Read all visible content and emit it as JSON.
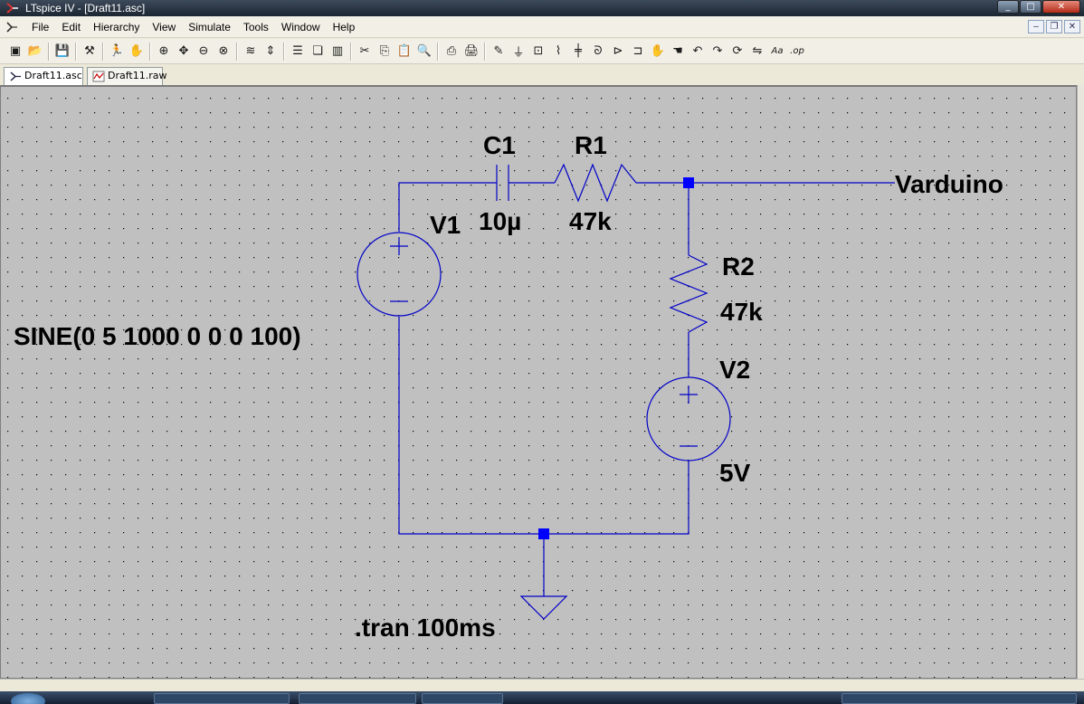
{
  "window": {
    "title": "LTspice IV - [Draft11.asc]",
    "controls": {
      "minimize": "_",
      "maximize": "□",
      "close": "✕"
    }
  },
  "menubar": {
    "items": [
      "File",
      "Edit",
      "Hierarchy",
      "View",
      "Simulate",
      "Tools",
      "Window",
      "Help"
    ],
    "mdi_controls": {
      "minimize": "–",
      "restore": "❐",
      "close": "✕"
    }
  },
  "toolbar": {
    "groups": [
      [
        "new-schematic-icon",
        "open-icon"
      ],
      [
        "save-icon"
      ],
      [
        "control-panel-icon"
      ],
      [
        "run-icon",
        "halt-icon"
      ],
      [
        "zoom-in-icon",
        "pan-icon",
        "zoom-out-icon",
        "zoom-fit-icon"
      ],
      [
        "waveform-icon",
        "autorange-icon"
      ],
      [
        "tile-horizontal-icon",
        "cascade-icon",
        "tile-vertical-icon"
      ],
      [
        "cut-icon",
        "copy-icon",
        "paste-icon",
        "find-icon"
      ],
      [
        "print-setup-icon",
        "print-icon"
      ],
      [
        "wire-icon",
        "ground-icon",
        "label-net-icon",
        "resistor-icon",
        "capacitor-icon",
        "inductor-icon",
        "diode-icon",
        "component-icon",
        "move-icon",
        "drag-icon",
        "undo-icon",
        "redo-icon",
        "rotate-icon",
        "mirror-icon",
        "text-icon",
        "spice-directive-icon"
      ]
    ],
    "glyphs": {
      "new-schematic-icon": "▣",
      "open-icon": "📂",
      "save-icon": "💾",
      "control-panel-icon": "⚒",
      "run-icon": "🏃",
      "halt-icon": "✋",
      "zoom-in-icon": "⊕",
      "pan-icon": "✥",
      "zoom-out-icon": "⊖",
      "zoom-fit-icon": "⊗",
      "waveform-icon": "≋",
      "autorange-icon": "⇕",
      "tile-horizontal-icon": "☰",
      "cascade-icon": "❏",
      "tile-vertical-icon": "▥",
      "cut-icon": "✂",
      "copy-icon": "⎘",
      "paste-icon": "📋",
      "find-icon": "🔍",
      "print-setup-icon": "⎙",
      "print-icon": "🖨",
      "wire-icon": "✎",
      "ground-icon": "⏚",
      "label-net-icon": "⊡",
      "resistor-icon": "⌇",
      "capacitor-icon": "╪",
      "inductor-icon": "ᘐ",
      "diode-icon": "⊳",
      "component-icon": "⊐",
      "move-icon": "✋",
      "drag-icon": "☚",
      "undo-icon": "↶",
      "redo-icon": "↷",
      "rotate-icon": "⟳",
      "mirror-icon": "⇋",
      "text-icon": "Aa",
      "spice-directive-icon": ".op"
    }
  },
  "tabs": [
    {
      "label": "Draft11.asc",
      "active": true,
      "icon": "schematic-icon"
    },
    {
      "label": "Draft11.raw",
      "active": false,
      "icon": "waveform-icon"
    }
  ],
  "schematic": {
    "components": {
      "c1": {
        "ref": "C1",
        "value": "10µ"
      },
      "r1": {
        "ref": "R1",
        "value": "47k"
      },
      "r2": {
        "ref": "R2",
        "value": "47k"
      },
      "v1": {
        "ref": "V1",
        "value": "SINE(0 5 1000 0 0 0 100)"
      },
      "v2": {
        "ref": "V2",
        "value": "5V"
      }
    },
    "net_label": "Varduino",
    "directive": ".tran 100ms",
    "colors": {
      "wire": "#0000c8",
      "junction": "#0000ff",
      "background": "#c0c0c0",
      "grid_dot": "#000000",
      "text": "#000000"
    }
  }
}
